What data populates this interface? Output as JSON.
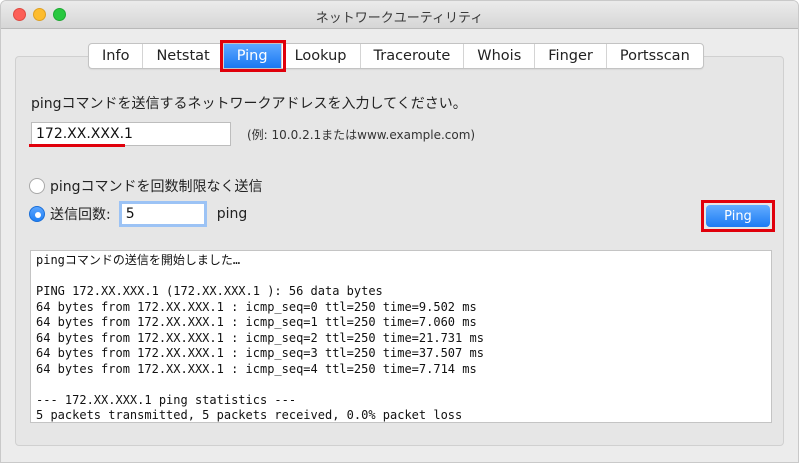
{
  "window": {
    "title": "ネットワークユーティリティ"
  },
  "tabs": [
    {
      "label": "Info",
      "active": false
    },
    {
      "label": "Netstat",
      "active": false
    },
    {
      "label": "Ping",
      "active": true
    },
    {
      "label": "Lookup",
      "active": false
    },
    {
      "label": "Traceroute",
      "active": false
    },
    {
      "label": "Whois",
      "active": false
    },
    {
      "label": "Finger",
      "active": false
    },
    {
      "label": "Portsscan",
      "active": false
    }
  ],
  "ping": {
    "instruction": "pingコマンドを送信するネットワークアドレスを入力してください。",
    "address_value": "172.XX.XXX.1",
    "example": "(例: 10.0.2.1またはwww.example.com)",
    "option_unlimited": "pingコマンドを回数制限なく送信",
    "option_count": "送信回数:",
    "count_value": "5",
    "count_unit": "ping",
    "selected_option": "count",
    "button_label": "Ping"
  },
  "output_lines": [
    "pingコマンドの送信を開始しました…",
    "",
    "PING 172.XX.XXX.1 (172.XX.XXX.1 ): 56 data bytes",
    "64 bytes from 172.XX.XXX.1 : icmp_seq=0 ttl=250 time=9.502 ms",
    "64 bytes from 172.XX.XXX.1 : icmp_seq=1 ttl=250 time=7.060 ms",
    "64 bytes from 172.XX.XXX.1 : icmp_seq=2 ttl=250 time=21.731 ms",
    "64 bytes from 172.XX.XXX.1 : icmp_seq=3 ttl=250 time=37.507 ms",
    "64 bytes from 172.XX.XXX.1 : icmp_seq=4 ttl=250 time=7.714 ms",
    "",
    "--- 172.XX.XXX.1 ping statistics ---",
    "5 packets transmitted, 5 packets received, 0.0% packet loss"
  ],
  "colors": {
    "accent": "#1a78f2",
    "highlight": "#e0000b"
  }
}
